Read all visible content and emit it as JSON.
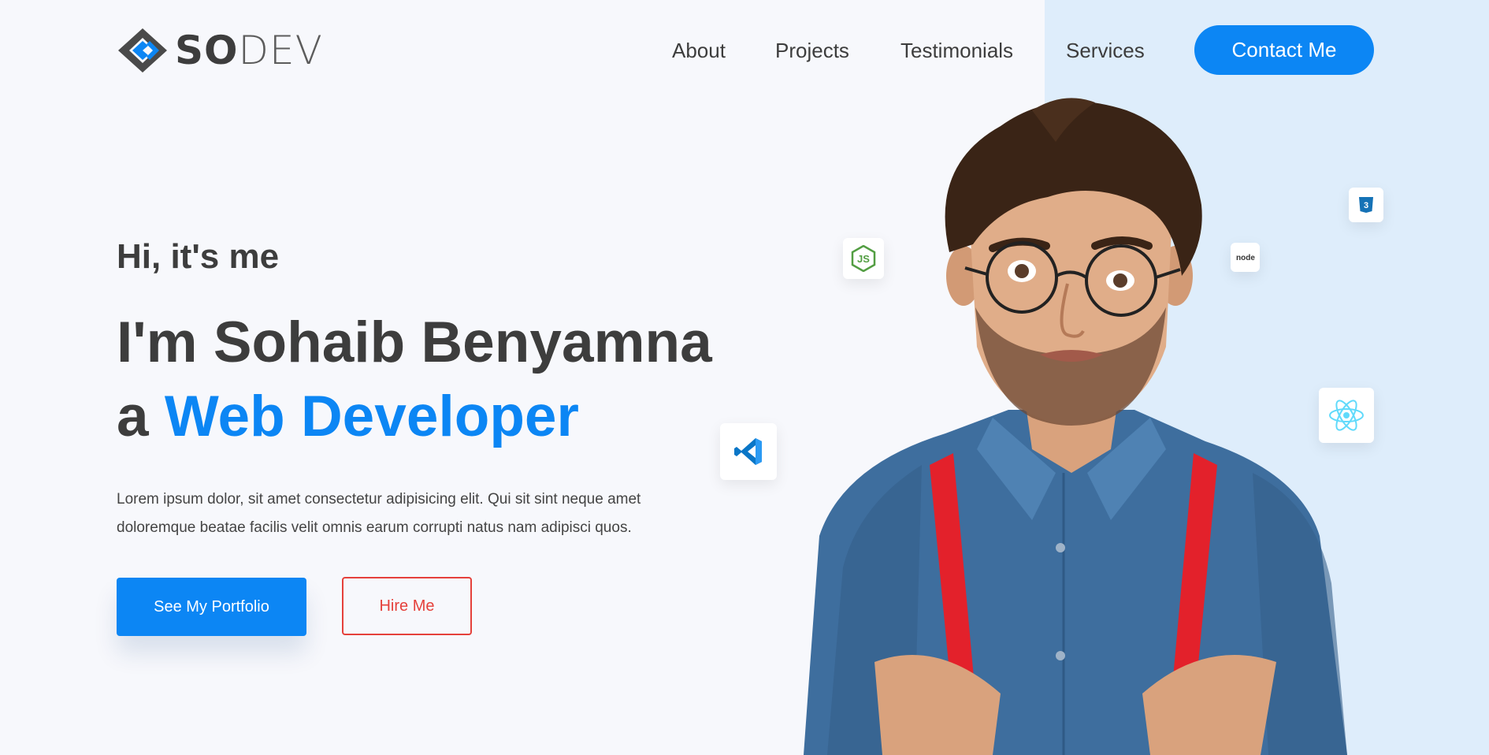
{
  "brand": {
    "logo_bold": "SO",
    "logo_light": "DEV"
  },
  "nav": {
    "items": [
      "About",
      "Projects",
      "Testimonials",
      "Services"
    ],
    "contact_label": "Contact Me"
  },
  "hero": {
    "greeting": "Hi, it's me",
    "name_line": "I'm Sohaib Benyamna",
    "role_prefix": "a ",
    "role": "Web Developer",
    "intro_line1": "Lorem ipsum dolor, sit amet consectetur adipisicing elit. Qui sit sint neque amet",
    "intro_line2": "doloremque beatae facilis velit omnis earum corrupti natus nam adipisci quos.",
    "portfolio_label": "See My Portfolio",
    "hire_label": "Hire Me"
  },
  "tech_icons": [
    "nodejs-js-icon",
    "node-wordmark-icon",
    "css3-icon",
    "vscode-icon",
    "react-icon"
  ],
  "colors": {
    "accent": "#0c86f4",
    "hire": "#e5413b",
    "text": "#3d3d3d",
    "panel": "#deedfb",
    "background": "#f7f8fc"
  }
}
